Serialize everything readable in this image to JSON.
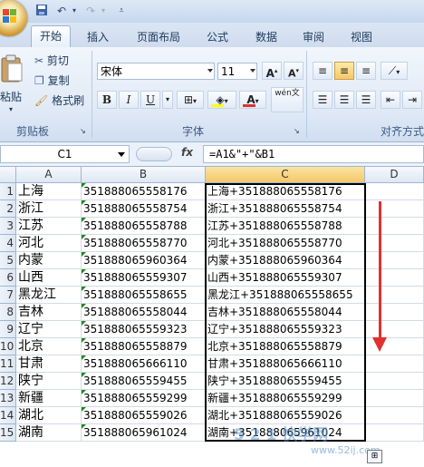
{
  "title_bar": {
    "quick_access": [
      "save-icon",
      "undo-icon",
      "redo-icon",
      "customize-icon"
    ]
  },
  "tabs": [
    "开始",
    "插入",
    "页面布局",
    "公式",
    "数据",
    "审阅",
    "视图"
  ],
  "ribbon": {
    "clipboard": {
      "paste": "粘贴",
      "cut": "剪切",
      "copy": "复制",
      "format_painter": "格式刷",
      "label": "剪贴板"
    },
    "font": {
      "name": "宋体",
      "size": "11",
      "bold": "B",
      "italic": "I",
      "underline": "U",
      "wen": "wén文",
      "label": "字体"
    },
    "alignment": {
      "label": "对齐方式"
    }
  },
  "formula_bar": {
    "name_box": "C1",
    "fx": "fx",
    "formula": "=A1&\"+\"&B1"
  },
  "grid": {
    "columns": [
      "A",
      "B",
      "C",
      "D"
    ],
    "rows": [
      {
        "n": "1",
        "a": "上海",
        "b": "351888065558176",
        "c": "上海+351888065558176"
      },
      {
        "n": "2",
        "a": "浙江",
        "b": "351888065558754",
        "c": "浙江+351888065558754"
      },
      {
        "n": "3",
        "a": "江苏",
        "b": "351888065558788",
        "c": "江苏+351888065558788"
      },
      {
        "n": "4",
        "a": "河北",
        "b": "351888065558770",
        "c": "河北+351888065558770"
      },
      {
        "n": "5",
        "a": "内蒙",
        "b": "351888065960364",
        "c": "内蒙+351888065960364"
      },
      {
        "n": "6",
        "a": "山西",
        "b": "351888065559307",
        "c": "山西+351888065559307"
      },
      {
        "n": "7",
        "a": "黑龙江",
        "b": "351888065558655",
        "c": "黑龙江+351888065558655"
      },
      {
        "n": "8",
        "a": "吉林",
        "b": "351888065558044",
        "c": "吉林+351888065558044"
      },
      {
        "n": "9",
        "a": "辽宁",
        "b": "351888065559323",
        "c": "辽宁+351888065559323"
      },
      {
        "n": "10",
        "a": "北京",
        "b": "351888065558879",
        "c": "北京+351888065558879"
      },
      {
        "n": "11",
        "a": "甘肃",
        "b": "351888065666110",
        "c": "甘肃+351888065666110"
      },
      {
        "n": "12",
        "a": "陕宁",
        "b": "351888065559455",
        "c": "陕宁+351888065559455"
      },
      {
        "n": "13",
        "a": "新疆",
        "b": "351888065559299",
        "c": "新疆+351888065559299"
      },
      {
        "n": "14",
        "a": "湖北",
        "b": "351888065559026",
        "c": "湖北+351888065559026"
      },
      {
        "n": "15",
        "a": "湖南",
        "b": "351888065961024",
        "c": "湖南+351888065961024"
      }
    ]
  },
  "watermark": {
    "main": "5 2 1 快学网",
    "url": "www.52ij.com"
  },
  "colors": {
    "ribbon": "#dfe9f6",
    "accent_arrow": "#e03030"
  }
}
